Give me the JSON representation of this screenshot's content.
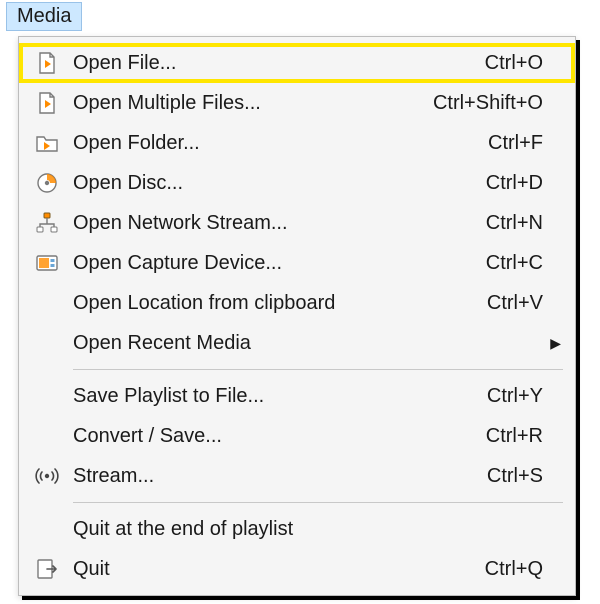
{
  "menubar": {
    "media": "Media"
  },
  "items": [
    {
      "label": "Open File...",
      "shortcut": "Ctrl+O",
      "icon": "file-play",
      "highlight": true
    },
    {
      "label": "Open Multiple Files...",
      "shortcut": "Ctrl+Shift+O",
      "icon": "file-play"
    },
    {
      "label": "Open Folder...",
      "shortcut": "Ctrl+F",
      "icon": "folder-play"
    },
    {
      "label": "Open Disc...",
      "shortcut": "Ctrl+D",
      "icon": "disc"
    },
    {
      "label": "Open Network Stream...",
      "shortcut": "Ctrl+N",
      "icon": "network"
    },
    {
      "label": "Open Capture Device...",
      "shortcut": "Ctrl+C",
      "icon": "capture"
    },
    {
      "label": "Open Location from clipboard",
      "shortcut": "Ctrl+V",
      "icon": ""
    },
    {
      "label": "Open Recent Media",
      "shortcut": "",
      "icon": "",
      "submenu": true
    },
    {
      "sep": true
    },
    {
      "label": "Save Playlist to File...",
      "shortcut": "Ctrl+Y",
      "icon": ""
    },
    {
      "label": "Convert / Save...",
      "shortcut": "Ctrl+R",
      "icon": ""
    },
    {
      "label": "Stream...",
      "shortcut": "Ctrl+S",
      "icon": "stream"
    },
    {
      "sep": true
    },
    {
      "label": "Quit at the end of playlist",
      "shortcut": "",
      "icon": ""
    },
    {
      "label": "Quit",
      "shortcut": "Ctrl+Q",
      "icon": "quit"
    }
  ]
}
